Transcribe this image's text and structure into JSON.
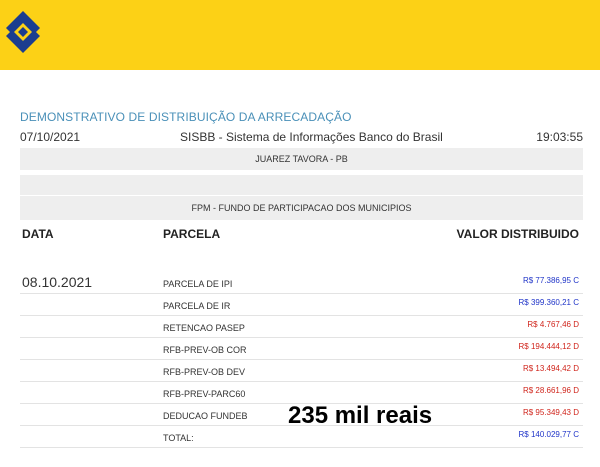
{
  "report": {
    "title": "DEMONSTRATIVO DE DISTRIBUIÇÃO DA ARRECADAÇÃO",
    "date": "07/10/2021",
    "system": "SISBB - Sistema de Informações Banco do Brasil",
    "time": "19:03:55",
    "municipality": "JUAREZ TAVORA - PB",
    "fund": "FPM - FUNDO DE PARTICIPACAO DOS MUNICIPIOS"
  },
  "table": {
    "headers": [
      "DATA",
      "PARCELA",
      "VALOR DISTRIBUIDO"
    ],
    "rows": [
      {
        "date": "08.10.2021",
        "parcela": "PARCELA DE IPI",
        "valor": "R$ 77.386,95 C"
      },
      {
        "date": "",
        "parcela": "PARCELA DE IR",
        "valor": "R$ 399.360,21 C"
      },
      {
        "date": "",
        "parcela": "RETENCAO PASEP",
        "valor": "R$ 4.767,46 D"
      },
      {
        "date": "",
        "parcela": "RFB-PREV-OB COR",
        "valor": "R$ 194.444,12 D"
      },
      {
        "date": "",
        "parcela": "RFB-PREV-OB DEV",
        "valor": "R$ 13.494,42 D"
      },
      {
        "date": "",
        "parcela": "RFB-PREV-PARC60",
        "valor": "R$ 28.661,96 D"
      },
      {
        "date": "",
        "parcela": "DEDUCAO FUNDEB",
        "valor": "R$ 95.349,43 D"
      },
      {
        "date": "",
        "parcela": "TOTAL:",
        "valor": "R$ 140.029,77 C"
      }
    ]
  },
  "overlay_text": "235 mil reais",
  "colors": {
    "header_yellow": "#fcd116",
    "logo_blue": "#1b3d8f",
    "title_blue": "#4a90b8",
    "credit_blue": "#1f34c8",
    "debit_red": "#d0251c",
    "band_gray": "#eeeeee"
  },
  "icons": {
    "logo": "banco-do-brasil-logo-icon"
  }
}
